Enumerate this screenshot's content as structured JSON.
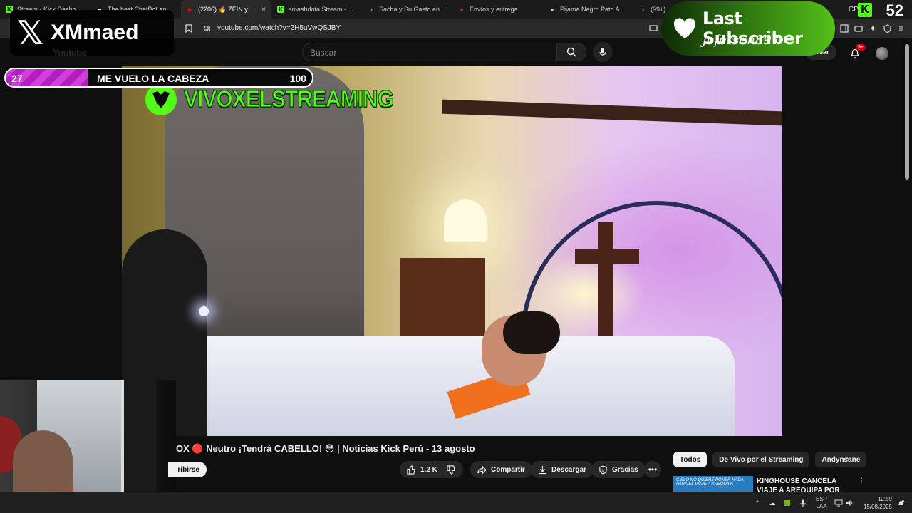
{
  "browser": {
    "tabs": [
      {
        "title": "Stream - Kick Dashboard",
        "icon": "kick-icon",
        "color": "#53fc18"
      },
      {
        "title": "The best ChatBot and Widgets",
        "icon": "chatbot-icon",
        "color": "#ffffff"
      },
      {
        "title": "(2206) 🔥 ZEIN y S...",
        "icon": "youtube-icon",
        "color": "#ff0000",
        "active": true
      },
      {
        "title": "smashdota Stream - Watch",
        "icon": "kick-icon",
        "color": "#53fc18"
      },
      {
        "title": "Sacha y Su Gasto en Roblox",
        "icon": "tiktok-icon",
        "color": "#ffffff"
      },
      {
        "title": "Envíos y entrega",
        "icon": "store-icon",
        "color": "#e0245e"
      },
      {
        "title": "Pijama Negro Pato Adulto",
        "icon": "shop-icon",
        "color": "#e8e07a"
      },
      {
        "title": "(99+)",
        "icon": "tiktok-icon",
        "color": "#ffffff"
      }
    ],
    "close_tab": "×",
    "cpu_label": "CPU",
    "cpu_value": "52",
    "url": "youtube.com/watch?v=2H5uVwQSJBY"
  },
  "youtube": {
    "logo": "Youtube",
    "search_placeholder": "Buscar",
    "create_label": "Crear",
    "notif_count": "9+",
    "video_title": "OX 🔴 Neutro ¡Tendrá CABELLO! 😳 | Noticias Kick Perú - 13 agosto",
    "subscribe_label": "Suscribirse",
    "likes": "1.2 K",
    "share_label": "Compartir",
    "download_label": "Descargar",
    "thanks_label": "Gracias",
    "chips": [
      "Todos",
      "De Vivo por el Streaming",
      "Andynsane"
    ],
    "recommended": {
      "thumb_text": "CIELO NO QUIERE PONER NADA PARA EL VIAJE A AREQUIPA",
      "title": "KINGHOUSE CANCELA VIAJE A AREQUIPA POR CULPA DE"
    }
  },
  "video_overlay": {
    "channel_watermark": "VIVOXELSTREAMING"
  },
  "stream_overlay": {
    "badge_name": "XMmaed",
    "goal": {
      "current": 27,
      "max": 100,
      "title": "ME VUELO LA CABEZA"
    },
    "last_subscriber_title": "Last Subscriber",
    "last_subscriber_name": "jeferson897"
  },
  "taskbar": {
    "lang_top": "ESP",
    "lang_bottom": "LAA",
    "time": "12:59",
    "date": "15/08/2025"
  },
  "colors": {
    "kick_green": "#53fc18",
    "goal_purple": "#d040d8",
    "yt_bg": "#0f0f0f"
  }
}
